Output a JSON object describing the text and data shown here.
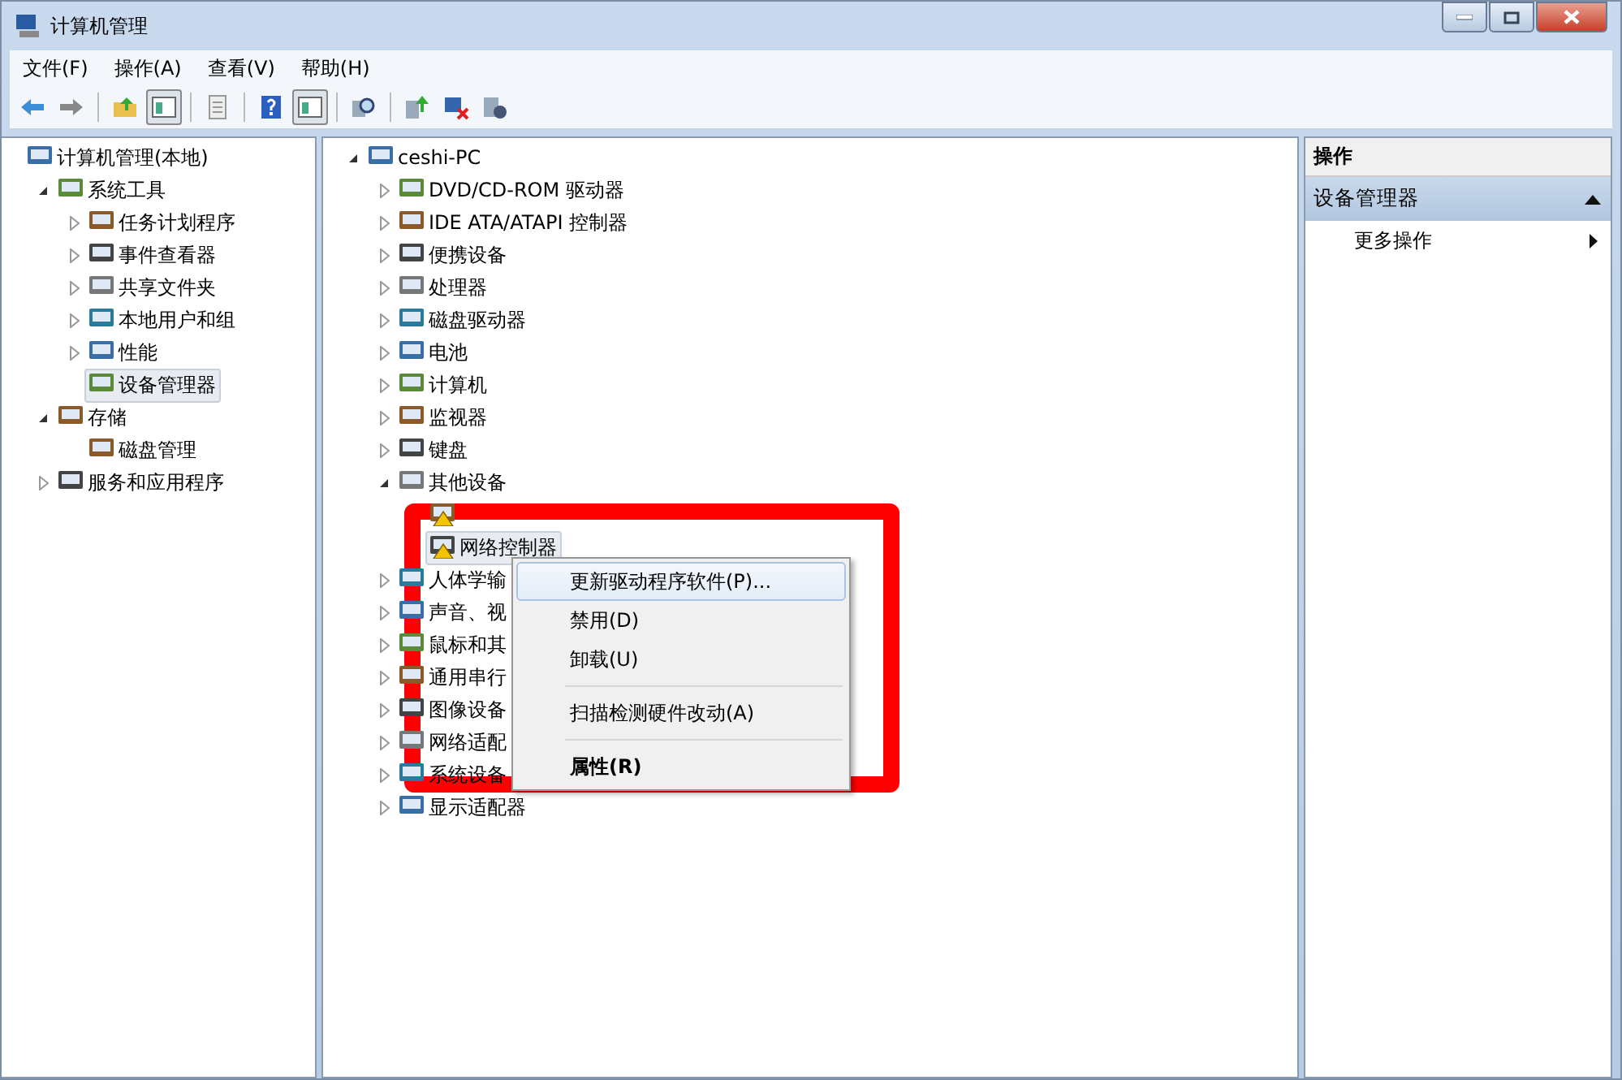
{
  "window": {
    "title": "计算机管理"
  },
  "menu": [
    "文件(F)",
    "操作(A)",
    "查看(V)",
    "帮助(H)"
  ],
  "toolbar": [
    {
      "kind": "back",
      "selected": false
    },
    {
      "kind": "forward",
      "selected": false
    },
    {
      "kind": "sep"
    },
    {
      "kind": "up",
      "selected": false
    },
    {
      "kind": "pane",
      "selected": true
    },
    {
      "kind": "sep"
    },
    {
      "kind": "list",
      "selected": false
    },
    {
      "kind": "sep"
    },
    {
      "kind": "help",
      "selected": false
    },
    {
      "kind": "pane",
      "selected": true
    },
    {
      "kind": "sep"
    },
    {
      "kind": "scan",
      "selected": false
    },
    {
      "kind": "sep"
    },
    {
      "kind": "update",
      "selected": false
    },
    {
      "kind": "remove",
      "selected": false
    },
    {
      "kind": "install",
      "selected": false
    }
  ],
  "nav_tree": [
    {
      "label": "计算机管理(本地)",
      "selected": false,
      "children": [
        {
          "label": "系统工具",
          "expanded": true,
          "selected": false,
          "children": [
            {
              "label": "任务计划程序",
              "expanded": false,
              "selected": false
            },
            {
              "label": "事件查看器",
              "expanded": false,
              "selected": false
            },
            {
              "label": "共享文件夹",
              "expanded": false,
              "selected": false
            },
            {
              "label": "本地用户和组",
              "expanded": false,
              "selected": false
            },
            {
              "label": "性能",
              "expanded": false,
              "selected": false
            },
            {
              "label": "设备管理器",
              "selected": true
            }
          ]
        },
        {
          "label": "存储",
          "expanded": true,
          "selected": false,
          "children": [
            {
              "label": "磁盘管理",
              "selected": false
            }
          ]
        },
        {
          "label": "服务和应用程序",
          "expanded": false,
          "selected": false
        }
      ]
    }
  ],
  "device_tree": [
    {
      "label": "ceshi-PC",
      "expanded": true,
      "selected": false,
      "children": [
        {
          "label": "DVD/CD-ROM 驱动器",
          "expanded": false,
          "selected": false
        },
        {
          "label": "IDE ATA/ATAPI 控制器",
          "expanded": false,
          "selected": false
        },
        {
          "label": "便携设备",
          "expanded": false,
          "selected": false
        },
        {
          "label": "处理器",
          "expanded": false,
          "selected": false
        },
        {
          "label": "磁盘驱动器",
          "expanded": false,
          "selected": false
        },
        {
          "label": "电池",
          "expanded": false,
          "selected": false
        },
        {
          "label": "计算机",
          "expanded": false,
          "selected": false
        },
        {
          "label": "监视器",
          "expanded": false,
          "selected": false
        },
        {
          "label": "键盘",
          "expanded": false,
          "selected": false
        },
        {
          "label": "其他设备",
          "expanded": true,
          "selected": false,
          "children": [
            {
              "warning": true,
              "selected": false
            },
            {
              "label": "网络控制器",
              "warning": true,
              "selected": true
            }
          ]
        },
        {
          "label": "人体学输",
          "expanded": false,
          "selected": false
        },
        {
          "label": "声音、视",
          "expanded": false,
          "selected": false
        },
        {
          "label": "鼠标和其",
          "expanded": false,
          "selected": false
        },
        {
          "label": "通用串行",
          "expanded": false,
          "selected": false
        },
        {
          "label": "图像设备",
          "expanded": false,
          "selected": false
        },
        {
          "label": "网络适配",
          "expanded": false,
          "selected": false
        },
        {
          "label": "系统设备",
          "expanded": false,
          "selected": false
        },
        {
          "label": "显示适配器",
          "expanded": false,
          "selected": false
        }
      ]
    }
  ],
  "context_menu": [
    {
      "kind": "item",
      "label": "更新驱动程序软件(P)...",
      "selected": true,
      "bold": false
    },
    {
      "kind": "item",
      "label": "禁用(D)",
      "selected": false,
      "bold": false
    },
    {
      "kind": "item",
      "label": "卸载(U)",
      "selected": false,
      "bold": false
    },
    {
      "kind": "separator"
    },
    {
      "kind": "item",
      "label": "扫描检测硬件改动(A)",
      "selected": false,
      "bold": false
    },
    {
      "kind": "separator"
    },
    {
      "kind": "item",
      "label": "属性(R)",
      "selected": false,
      "bold": true
    }
  ],
  "actions": {
    "header": "操作",
    "section": {
      "label": "设备管理器",
      "expanded": true
    },
    "items": [
      "更多操作"
    ]
  }
}
